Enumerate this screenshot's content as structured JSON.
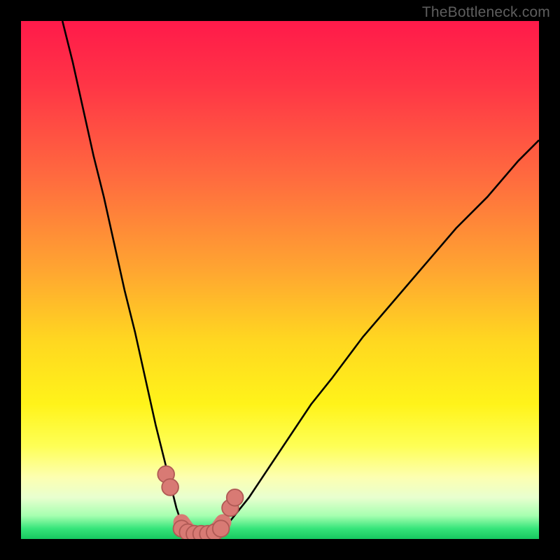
{
  "watermark": {
    "text": "TheBottleneck.com"
  },
  "colors": {
    "black": "#000000",
    "curve_stroke": "#000000",
    "marker_fill": "#d87a74",
    "marker_stroke": "#b05a55",
    "gradient_stops": [
      {
        "offset": 0.0,
        "color": "#ff1a4a"
      },
      {
        "offset": 0.12,
        "color": "#ff3446"
      },
      {
        "offset": 0.3,
        "color": "#ff6a3f"
      },
      {
        "offset": 0.48,
        "color": "#ffa531"
      },
      {
        "offset": 0.62,
        "color": "#ffd820"
      },
      {
        "offset": 0.74,
        "color": "#fff31a"
      },
      {
        "offset": 0.82,
        "color": "#feff55"
      },
      {
        "offset": 0.88,
        "color": "#fdffb0"
      },
      {
        "offset": 0.92,
        "color": "#e8ffcf"
      },
      {
        "offset": 0.955,
        "color": "#a6ffb0"
      },
      {
        "offset": 0.98,
        "color": "#36e57a"
      },
      {
        "offset": 1.0,
        "color": "#17c85f"
      }
    ]
  },
  "chart_data": {
    "type": "line",
    "title": "",
    "xlabel": "",
    "ylabel": "",
    "xlim": [
      0,
      100
    ],
    "ylim": [
      0,
      100
    ],
    "grid": false,
    "legend": false,
    "series": [
      {
        "name": "left-branch",
        "x": [
          8,
          10,
          12,
          14,
          16,
          18,
          20,
          22,
          24,
          26,
          28,
          30,
          31,
          32,
          33
        ],
        "y": [
          100,
          92,
          83,
          74,
          66,
          57,
          48,
          40,
          31,
          22,
          14,
          6,
          3,
          1.5,
          1
        ]
      },
      {
        "name": "right-branch",
        "x": [
          37,
          38,
          40,
          44,
          48,
          52,
          56,
          60,
          66,
          72,
          78,
          84,
          90,
          96,
          100
        ],
        "y": [
          1,
          1.5,
          3,
          8,
          14,
          20,
          26,
          31,
          39,
          46,
          53,
          60,
          66,
          73,
          77
        ]
      },
      {
        "name": "trough-curve",
        "x": [
          31,
          32,
          33,
          34,
          35,
          36,
          37,
          38,
          39
        ],
        "y": [
          3.2,
          1.8,
          1.1,
          0.8,
          0.8,
          0.8,
          1.1,
          1.8,
          3.2
        ]
      }
    ],
    "markers": {
      "name": "highlight-points",
      "x": [
        28.0,
        28.8,
        31.0,
        32.2,
        33.5,
        34.8,
        36.1,
        37.4,
        38.6,
        40.4,
        41.3
      ],
      "y": [
        12.5,
        10.0,
        2.0,
        1.3,
        1.0,
        1.0,
        1.0,
        1.3,
        2.0,
        6.0,
        8.0
      ],
      "r": 1.6
    },
    "annotations": []
  }
}
